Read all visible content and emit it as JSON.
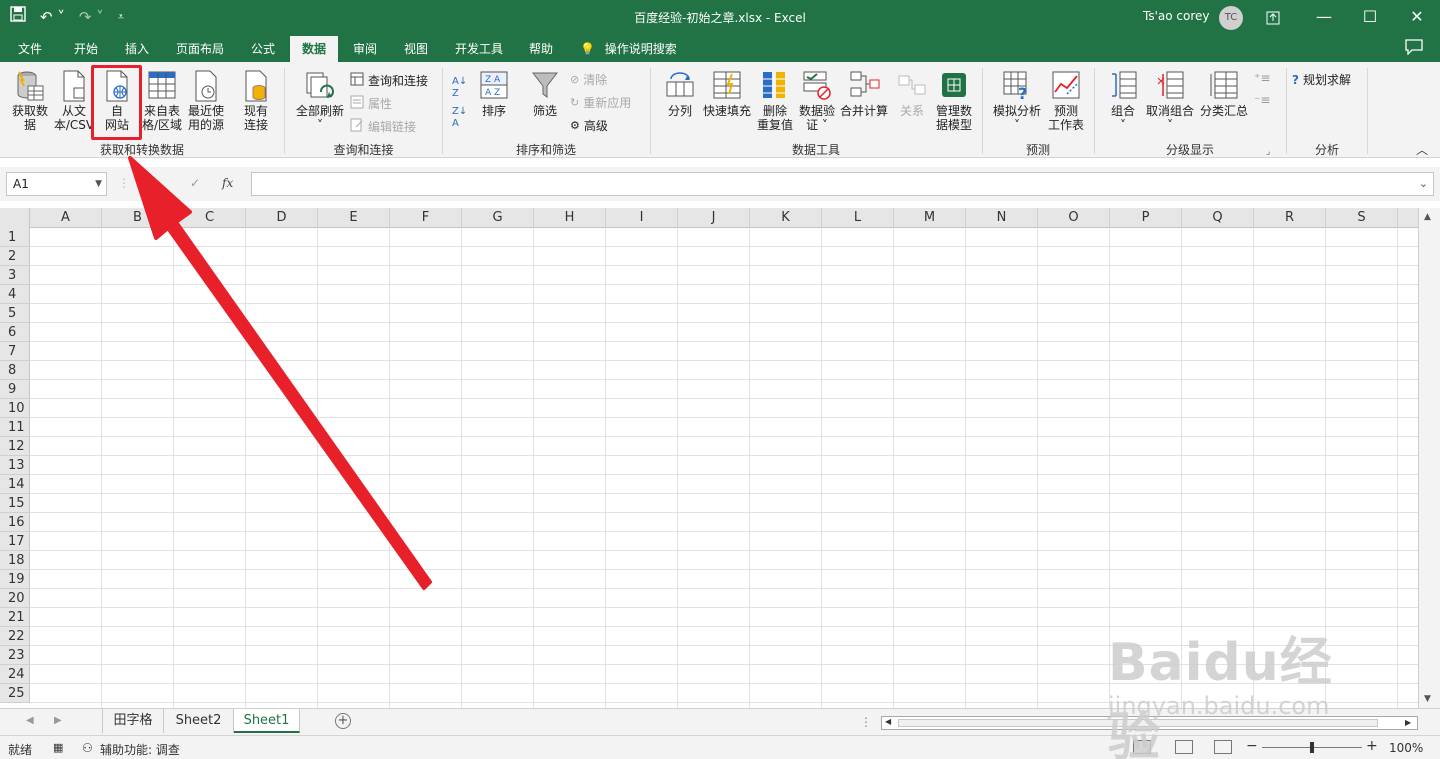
{
  "window": {
    "title": "百度经验-初始之章.xlsx  -  Excel",
    "user_name": "Ts'ao corey",
    "user_initials": "TC"
  },
  "tabs": [
    "文件",
    "开始",
    "插入",
    "页面布局",
    "公式",
    "数据",
    "审阅",
    "视图",
    "开发工具",
    "帮助",
    "操作说明搜索"
  ],
  "active_tab": "数据",
  "ribbon": {
    "get_data": {
      "line1": "获取数",
      "line2": "据",
      "arrow": "˅"
    },
    "from_csv": {
      "line1": "从文",
      "line2": "本/CSV"
    },
    "from_web": {
      "line1": "自",
      "line2": "网站"
    },
    "from_table": {
      "line1": "来自表",
      "line2": "格/区域"
    },
    "recent_sources": {
      "line1": "最近使",
      "line2": "用的源"
    },
    "existing_conn": {
      "line1": "现有",
      "line2": "连接"
    },
    "refresh_all": {
      "line1": "全部刷新",
      "line2": "˅"
    },
    "queries_conn": "查询和连接",
    "properties": "属性",
    "edit_links": "编辑链接",
    "sort": "排序",
    "filter": "筛选",
    "clear": "清除",
    "reapply": "重新应用",
    "advanced": "高级",
    "text_to_columns": "分列",
    "flash_fill": "快速填充",
    "remove_dup": {
      "line1": "删除",
      "line2": "重复值"
    },
    "data_validation": {
      "line1": "数据验",
      "line2": "证 ˅"
    },
    "consolidate": "合并计算",
    "relationships": "关系",
    "data_model": {
      "line1": "管理数",
      "line2": "据模型"
    },
    "what_if": {
      "line1": "模拟分析",
      "line2": "˅"
    },
    "forecast_sheet": {
      "line1": "预测",
      "line2": "工作表"
    },
    "group": {
      "line1": "组合",
      "line2": "˅"
    },
    "ungroup": {
      "line1": "取消组合",
      "line2": "˅"
    },
    "subtotal": "分类汇总",
    "solver": "规划求解",
    "groups": [
      "获取和转换数据",
      "查询和连接",
      "排序和筛选",
      "数据工具",
      "预测",
      "分级显示",
      "分析"
    ]
  },
  "formula_bar": {
    "name_box": "A1",
    "fx": "fx",
    "value": ""
  },
  "columns": [
    "A",
    "B",
    "C",
    "D",
    "E",
    "F",
    "G",
    "H",
    "I",
    "J",
    "K",
    "L",
    "M",
    "N",
    "O",
    "P",
    "Q",
    "R",
    "S"
  ],
  "rows": [
    "1",
    "2",
    "3",
    "4",
    "5",
    "6",
    "7",
    "8",
    "9",
    "10",
    "11",
    "12",
    "13",
    "14",
    "15",
    "16",
    "17",
    "18",
    "19",
    "20",
    "21",
    "22",
    "23",
    "24",
    "25"
  ],
  "sheets": [
    "田字格",
    "Sheet2",
    "Sheet1"
  ],
  "active_sheet": "Sheet1",
  "status": {
    "ready": "就绪",
    "accessibility": "辅助功能: 调查",
    "zoom": "100%"
  },
  "watermark": {
    "brand": "Baidu经验",
    "url": "jingyan.baidu.com"
  },
  "colors": {
    "excel_green": "#217346",
    "highlight_red": "#e8202a"
  }
}
